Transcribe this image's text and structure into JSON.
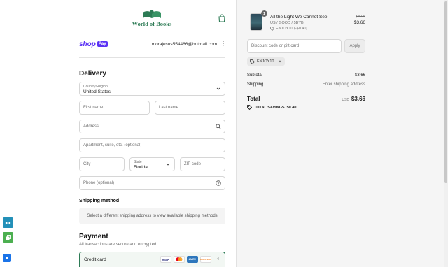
{
  "header": {
    "logo_text": "World of Books"
  },
  "account": {
    "shop_word": "shop",
    "pay_badge": "Pay",
    "email": "morajesus554466@hotmail.com"
  },
  "delivery": {
    "heading": "Delivery",
    "country_label": "Country/Region",
    "country_value": "United States",
    "first_name_placeholder": "First name",
    "last_name_placeholder": "Last name",
    "address_placeholder": "Address",
    "apartment_placeholder": "Apartment, suite, etc. (optional)",
    "city_placeholder": "City",
    "state_label": "State",
    "state_value": "Florida",
    "zip_placeholder": "ZIP code",
    "phone_placeholder": "Phone (optional)"
  },
  "shipping": {
    "heading": "Shipping method",
    "message": "Select a different shipping address to view available shipping methods"
  },
  "payment": {
    "heading": "Payment",
    "subtitle": "All transactions are secure and encrypted.",
    "credit_card_label": "Credit card",
    "cards": [
      "VISA",
      "",
      "AMEX",
      "DISCOVER"
    ],
    "more_cards": "+4"
  },
  "order": {
    "item": {
      "quantity": "1",
      "title": "All the Light We Cannot See",
      "variant": "US / GOOD / 5BYB",
      "discount": "ENJOY10 (-$0.40)",
      "original_price": "$4.06",
      "price": "$3.66"
    },
    "discount_placeholder": "Discount code or gift card",
    "apply_label": "Apply",
    "applied_code": "ENJOY10",
    "subtotal_label": "Subtotal",
    "subtotal_value": "$3.66",
    "shipping_label": "Shipping",
    "shipping_value": "Enter shipping address",
    "total_label": "Total",
    "currency": "USD",
    "total_value": "$3.66",
    "savings_label": "TOTAL SAVINGS",
    "savings_value": "$0.40"
  },
  "colors": {
    "brand_green": "#2d7b55",
    "shop_purple": "#5a31f4"
  }
}
